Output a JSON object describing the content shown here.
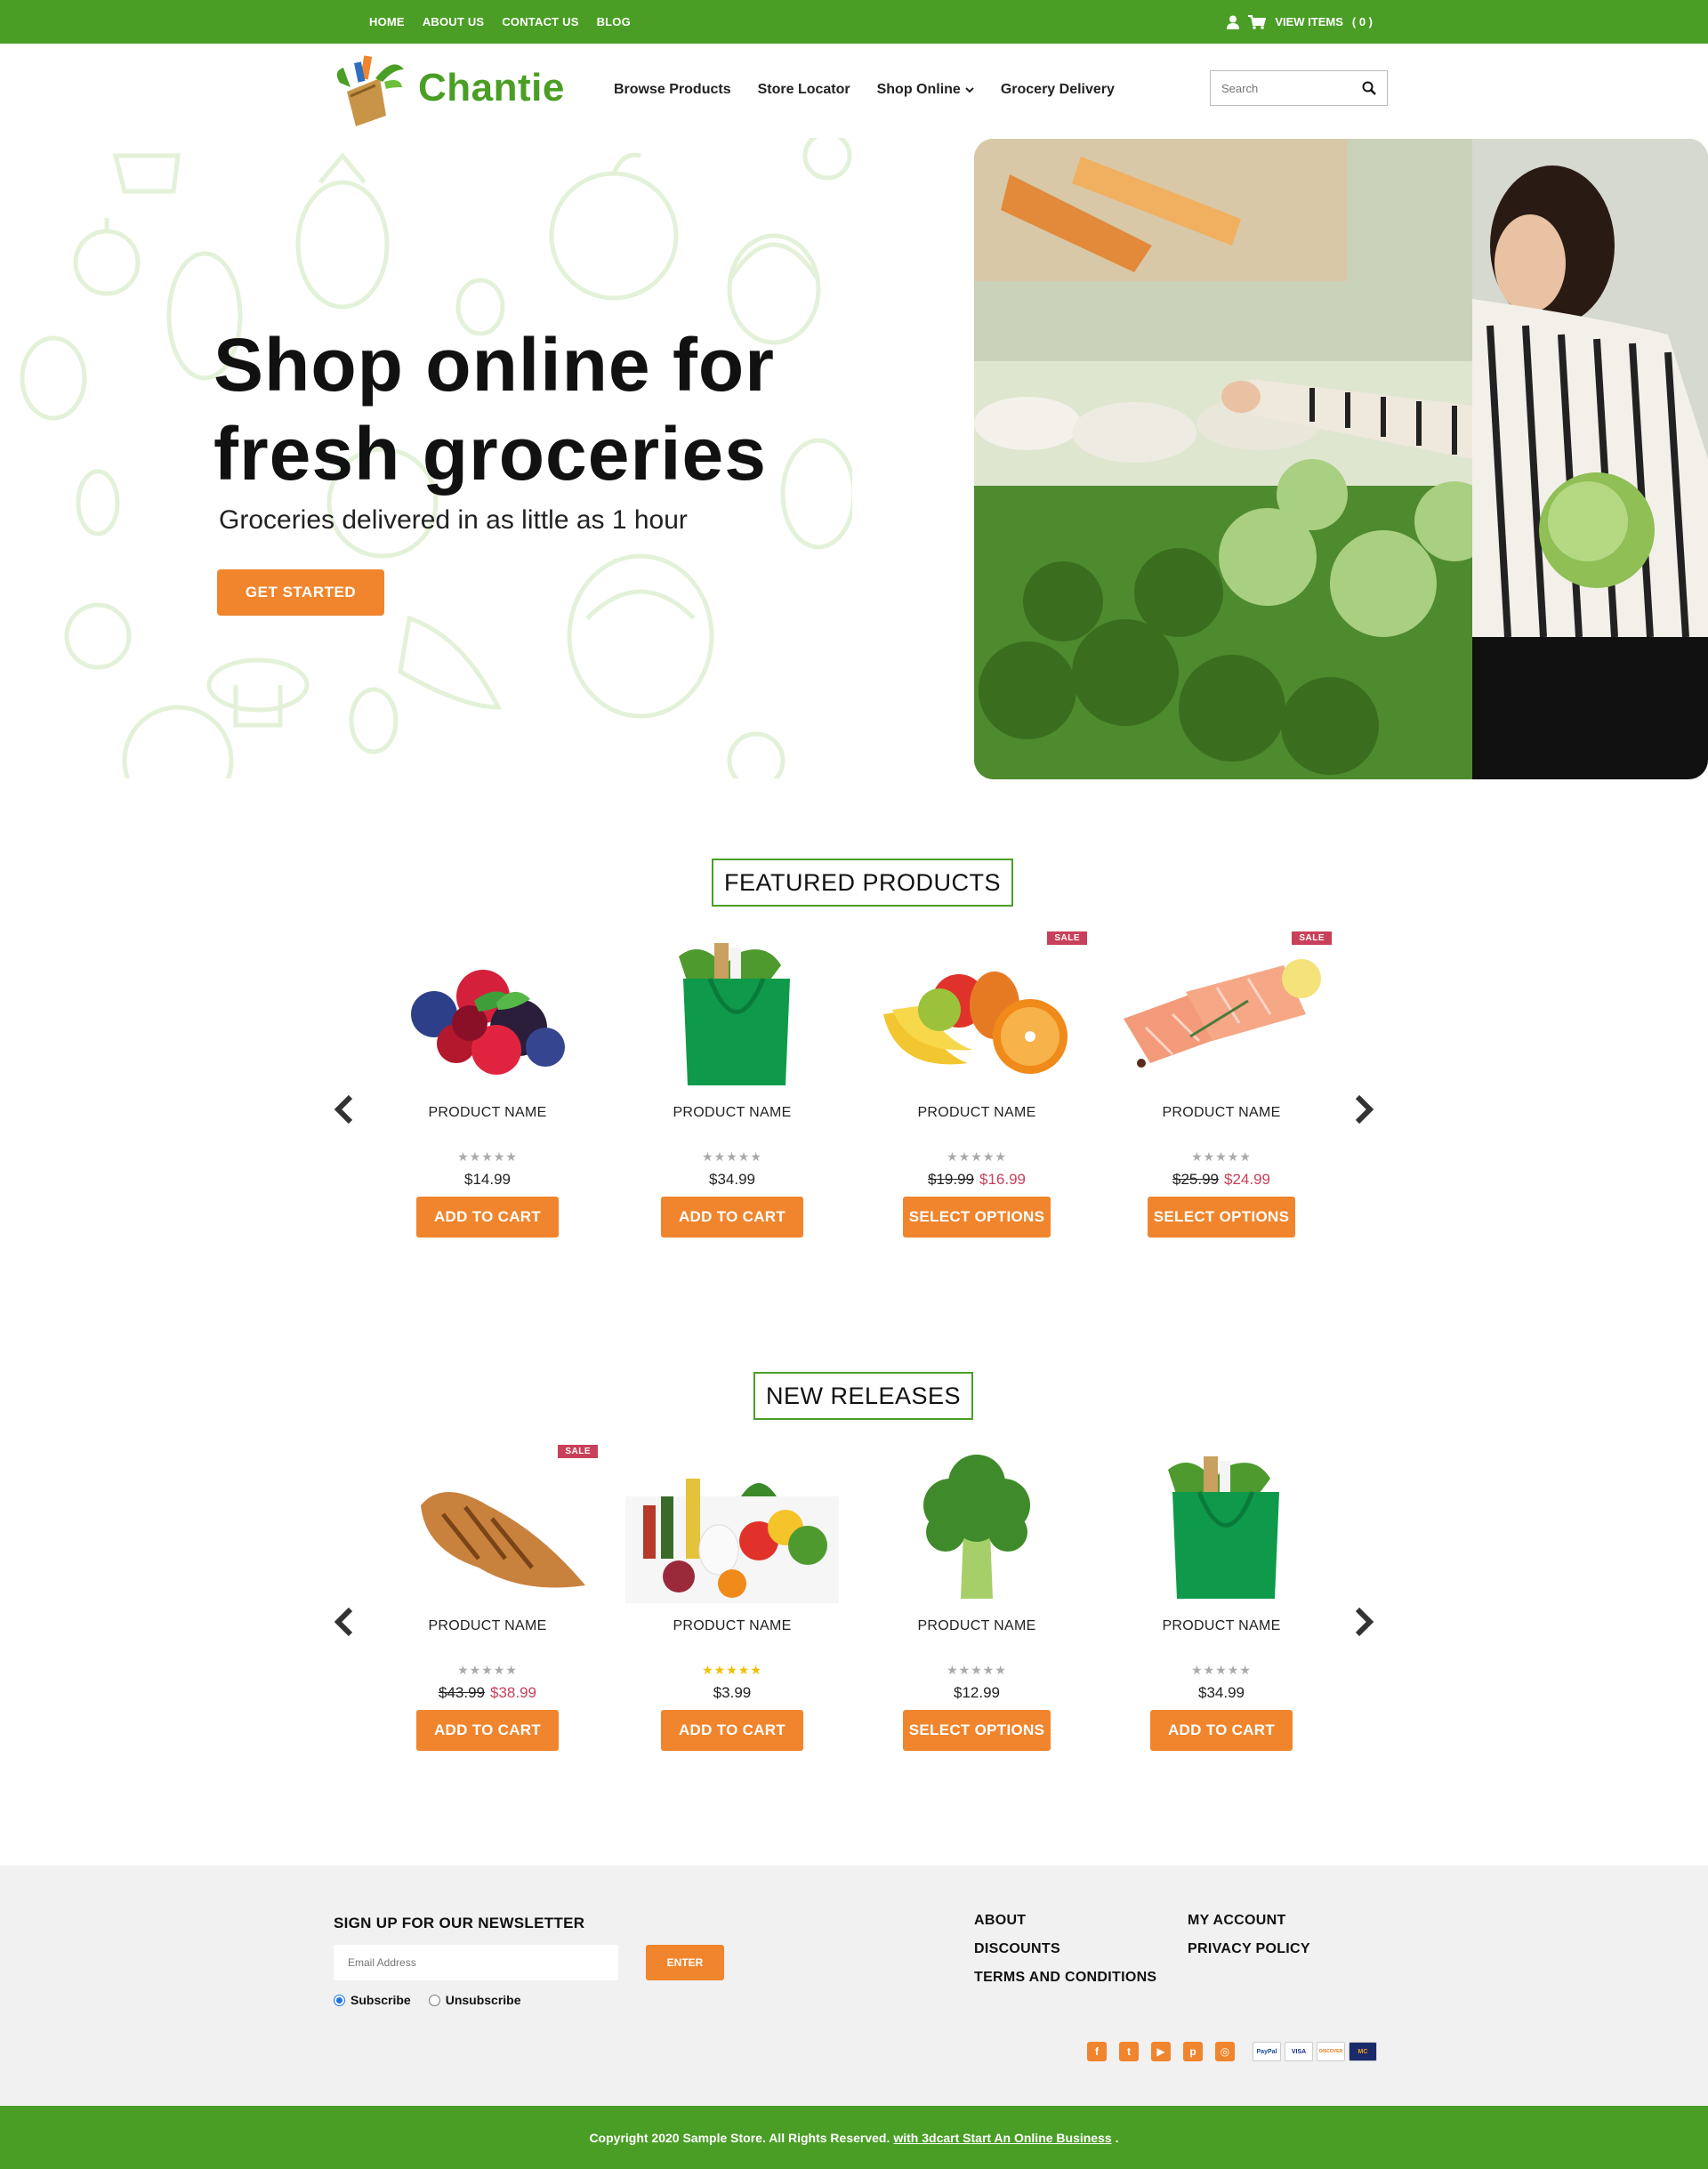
{
  "topbar": {
    "links": [
      "HOME",
      "ABOUT US",
      "CONTACT US",
      "BLOG"
    ],
    "view_items_label": "VIEW ITEMS",
    "cart_count": "( 0 )"
  },
  "header": {
    "logo_text": "Chantie",
    "nav": [
      "Browse Products",
      "Store Locator",
      "Shop Online",
      "Grocery Delivery"
    ],
    "search_placeholder": "Search"
  },
  "hero": {
    "title_line1": "Shop online for",
    "title_line2": "fresh groceries",
    "subtitle": "Groceries delivered in as little as 1 hour",
    "cta": "GET STARTED"
  },
  "featured": {
    "title": "FEATURED PRODUCTS",
    "products": [
      {
        "name": "PRODUCT NAME",
        "stars": "★★★★★",
        "price": "$14.99",
        "old_price": "",
        "new_price": "",
        "button": "ADD TO CART",
        "sale": ""
      },
      {
        "name": "PRODUCT NAME",
        "stars": "★★★★★",
        "price": "$34.99",
        "old_price": "",
        "new_price": "",
        "button": "ADD TO CART",
        "sale": ""
      },
      {
        "name": "PRODUCT NAME",
        "stars": "★★★★★",
        "price": "",
        "old_price": "$19.99",
        "new_price": "$16.99",
        "button": "SELECT OPTIONS",
        "sale": "SALE"
      },
      {
        "name": "PRODUCT NAME",
        "stars": "★★★★★",
        "price": "",
        "old_price": "$25.99",
        "new_price": "$24.99",
        "button": "SELECT OPTIONS",
        "sale": "SALE"
      }
    ]
  },
  "new_releases": {
    "title": "NEW RELEASES",
    "products": [
      {
        "name": "PRODUCT NAME",
        "stars": "★★★★★",
        "price": "",
        "old_price": "$43.99",
        "new_price": "$38.99",
        "button": "ADD TO CART",
        "sale": "SALE"
      },
      {
        "name": "PRODUCT NAME",
        "stars": "★★★★★",
        "price": "$3.99",
        "old_price": "",
        "new_price": "",
        "button": "ADD TO CART",
        "sale": ""
      },
      {
        "name": "PRODUCT NAME",
        "stars": "★★★★★",
        "price": "$12.99",
        "old_price": "",
        "new_price": "",
        "button": "SELECT OPTIONS",
        "sale": ""
      },
      {
        "name": "PRODUCT NAME",
        "stars": "★★★★★",
        "price": "$34.99",
        "old_price": "",
        "new_price": "",
        "button": "ADD TO CART",
        "sale": ""
      }
    ]
  },
  "footer": {
    "newsletter_title": "SIGN UP FOR OUR NEWSLETTER",
    "email_placeholder": "Email Address",
    "enter_label": "ENTER",
    "subscribe_label": "Subscribe",
    "unsubscribe_label": "Unsubscribe",
    "links_col1": [
      "ABOUT",
      "DISCOUNTS",
      "TERMS AND CONDITIONS"
    ],
    "links_col2": [
      "MY ACCOUNT",
      "PRIVACY POLICY"
    ],
    "social_icons": [
      "facebook-icon",
      "twitter-icon",
      "youtube-icon",
      "pinterest-icon",
      "instagram-icon"
    ],
    "payment": [
      "PayPal",
      "VISA",
      "DISCOVER",
      "MC"
    ],
    "copyright": "Copyright 2020 Sample Store. All Rights Reserved.",
    "copyright_link": "with 3dcart Start An Online Business",
    "copyright_end": "."
  },
  "colors": {
    "brand_green": "#4a9e25",
    "accent_orange": "#f0852d",
    "sale_red": "#c8405a"
  }
}
